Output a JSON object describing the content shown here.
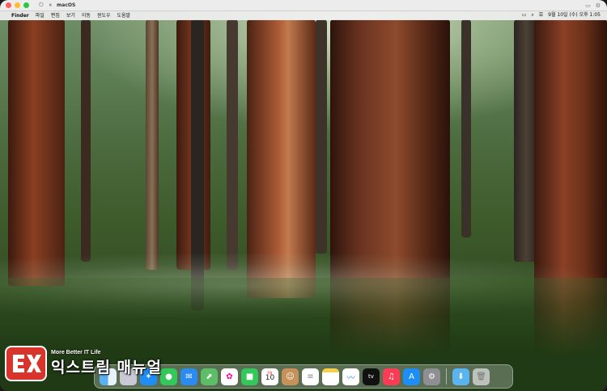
{
  "vm_window": {
    "title": "macOS"
  },
  "menubar": {
    "apple": "",
    "app_name": "Finder",
    "items": [
      "파일",
      "편집",
      "보기",
      "이동",
      "윈도우",
      "도움말"
    ],
    "clock": "9월 10일 (수) 오후 1:05"
  },
  "dock": {
    "apps": [
      "Finder",
      "Launchpad",
      "Safari",
      "Messages",
      "Mail",
      "Maps",
      "Photos",
      "FaceTime",
      "Calendar",
      "Contacts",
      "Reminders",
      "Notes",
      "Freeform",
      "TV",
      "Music",
      "App Store",
      "System Settings"
    ],
    "calendar_month": "9월",
    "calendar_day": "10",
    "tv_label": "tv",
    "extras": [
      "Downloads",
      "Trash"
    ]
  },
  "watermark": {
    "tagline": "More Better IT Life",
    "title": "익스트림 매뉴얼"
  }
}
